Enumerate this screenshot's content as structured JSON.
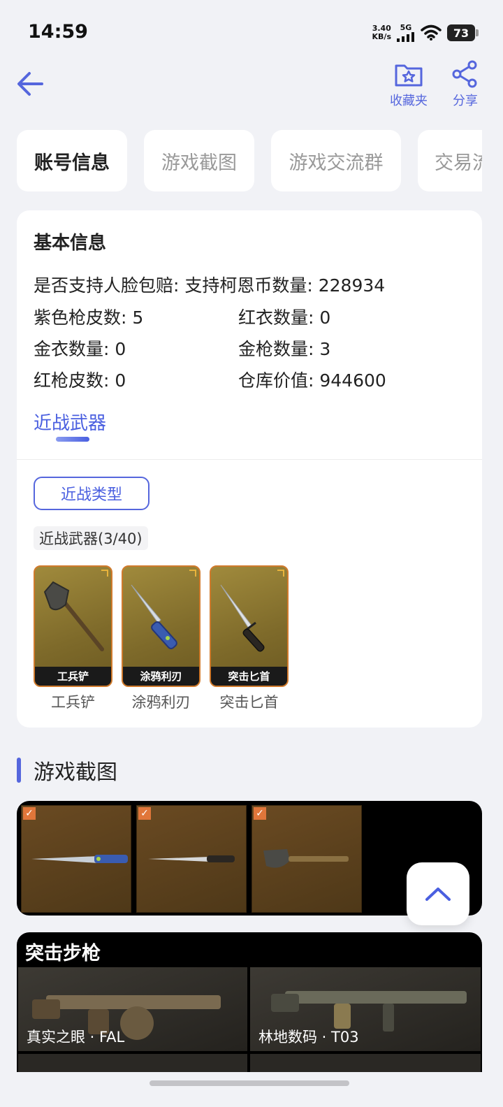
{
  "status": {
    "time": "14:59",
    "net_speed_value": "3.40",
    "net_speed_unit": "KB/s",
    "network": "5G",
    "battery": "73"
  },
  "header": {
    "favorites_label": "收藏夹",
    "share_label": "分享"
  },
  "tabs": [
    {
      "label": "账号信息"
    },
    {
      "label": "游戏截图"
    },
    {
      "label": "游戏交流群"
    },
    {
      "label": "交易流"
    }
  ],
  "basic_info": {
    "title": "基本信息",
    "face_compensation": "是否支持人脸包赔: 支持",
    "coin_count": "柯恩币数量: 228934",
    "purple_skins": "紫色枪皮数: 5",
    "red_outfits": "红衣数量: 0",
    "gold_outfits": "金衣数量: 0",
    "gold_guns": "金枪数量: 3",
    "red_skins": "红枪皮数: 0",
    "warehouse_value": "仓库价值: 944600"
  },
  "melee": {
    "section_tab": "近战武器",
    "type_button": "近战类型",
    "count_label": "近战武器(3/40)",
    "items": [
      {
        "name": "工兵铲",
        "caption": "工兵铲"
      },
      {
        "name": "涂鸦利刃",
        "caption": "涂鸦利刃"
      },
      {
        "name": "突击匕首",
        "caption": "突击匕首"
      }
    ]
  },
  "screenshots": {
    "heading": "游戏截图",
    "check_mark": "✓"
  },
  "rifles": {
    "title": "突击步枪",
    "items": [
      {
        "name": "真实之眼 · FAL"
      },
      {
        "name": "林地数码 · T03"
      }
    ]
  },
  "colors": {
    "accent": "#4a5fe0",
    "tile_border": "#d07a2c"
  }
}
